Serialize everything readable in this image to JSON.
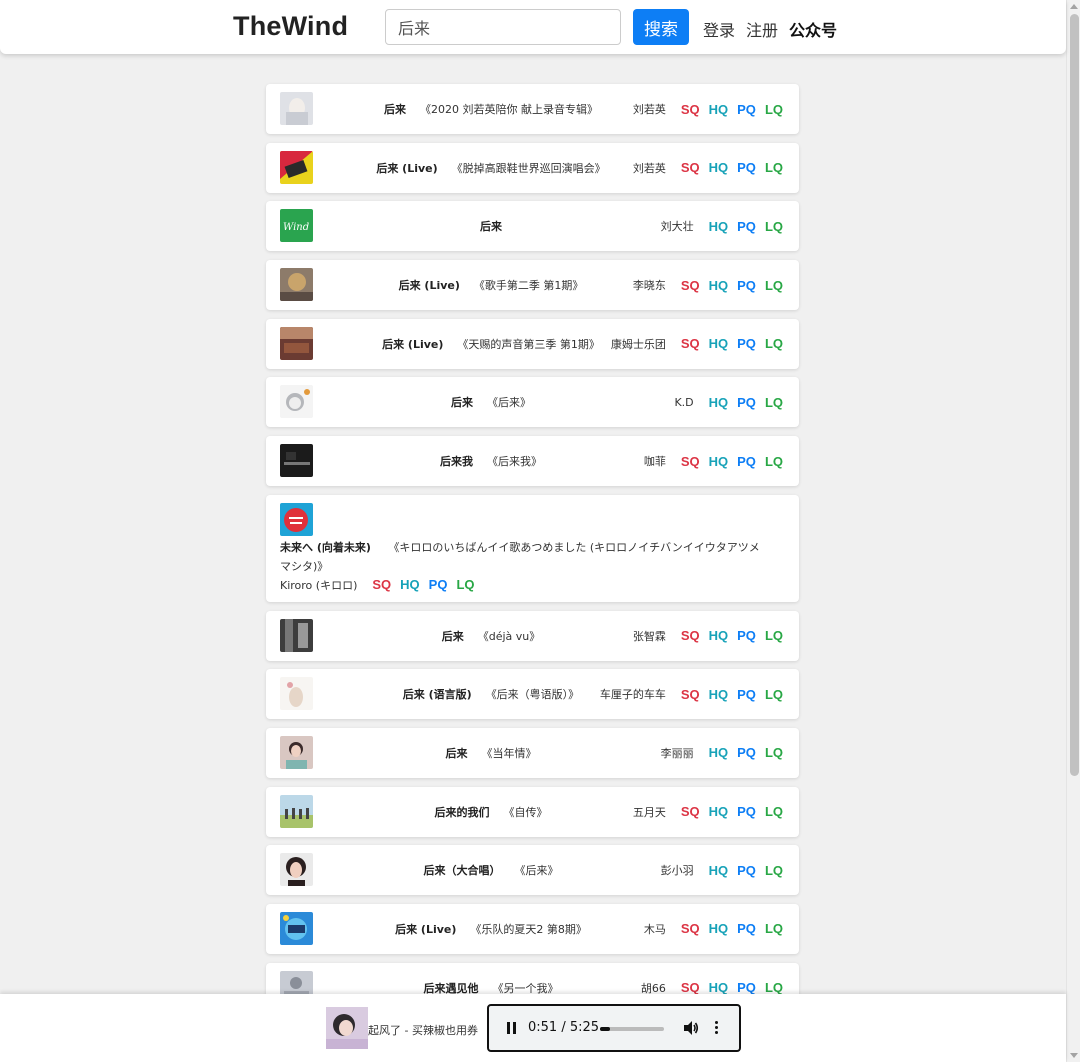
{
  "header": {
    "logo": "TheWind",
    "search_value": "后来",
    "search_button": "搜索",
    "nav": {
      "login": "登录",
      "register": "注册",
      "official": "公众号"
    }
  },
  "quality_labels": {
    "sq": "SQ",
    "hq": "HQ",
    "pq": "PQ",
    "lq": "LQ"
  },
  "colors": {
    "sq": "#dc3545",
    "hq": "#17a2b8",
    "pq": "#0d7ef5",
    "lq": "#28a745",
    "search_button": "#0d7ef5"
  },
  "songs": [
    {
      "title": "后来",
      "album": "《2020 刘若英陪你 献上录音专辑》",
      "artist": "刘若英",
      "sq": true
    },
    {
      "title": "后来 (Live)",
      "album": "《脱掉高跟鞋世界巡回演唱会》",
      "artist": "刘若英",
      "sq": true
    },
    {
      "title": "后来",
      "album": "",
      "artist": "刘大壮",
      "sq": false
    },
    {
      "title": "后来 (Live)",
      "album": "《歌手第二季 第1期》",
      "artist": "李晓东",
      "sq": true
    },
    {
      "title": "后来 (Live)",
      "album": "《天赐的声音第三季 第1期》",
      "artist": "康姆士乐团",
      "sq": true
    },
    {
      "title": "后来",
      "album": "《后来》",
      "artist": "K.D",
      "sq": false
    },
    {
      "title": "后来我",
      "album": "《后来我》",
      "artist": "咖菲",
      "sq": true
    },
    {
      "title": "未来へ (向着未来)",
      "album": "《キロロのいちばんイイ歌あつめました (キロロノイチバンイイウタアツメマシタ)》",
      "artist": "Kiroro (キロロ)",
      "sq": true
    },
    {
      "title": "后来",
      "album": "《déjà vu》",
      "artist": "张智霖",
      "sq": true
    },
    {
      "title": "后来 (语言版)",
      "album": "《后来（粤语版）》",
      "artist": "车厘子的车车",
      "sq": true
    },
    {
      "title": "后来",
      "album": "《当年情》",
      "artist": "李丽丽",
      "sq": false
    },
    {
      "title": "后来的我们",
      "album": "《自传》",
      "artist": "五月天",
      "sq": true
    },
    {
      "title": "后来（大合唱）",
      "album": "《后来》",
      "artist": "彭小羽",
      "sq": false
    },
    {
      "title": "后来 (Live)",
      "album": "《乐队的夏天2 第8期》",
      "artist": "木马",
      "sq": true
    },
    {
      "title": "后来遇见他",
      "album": "《另一个我》",
      "artist": "胡66",
      "sq": true
    }
  ],
  "player": {
    "song": "起风了 - 买辣椒也用券",
    "time": "0:51 / 5:25",
    "progress": 0.157
  }
}
